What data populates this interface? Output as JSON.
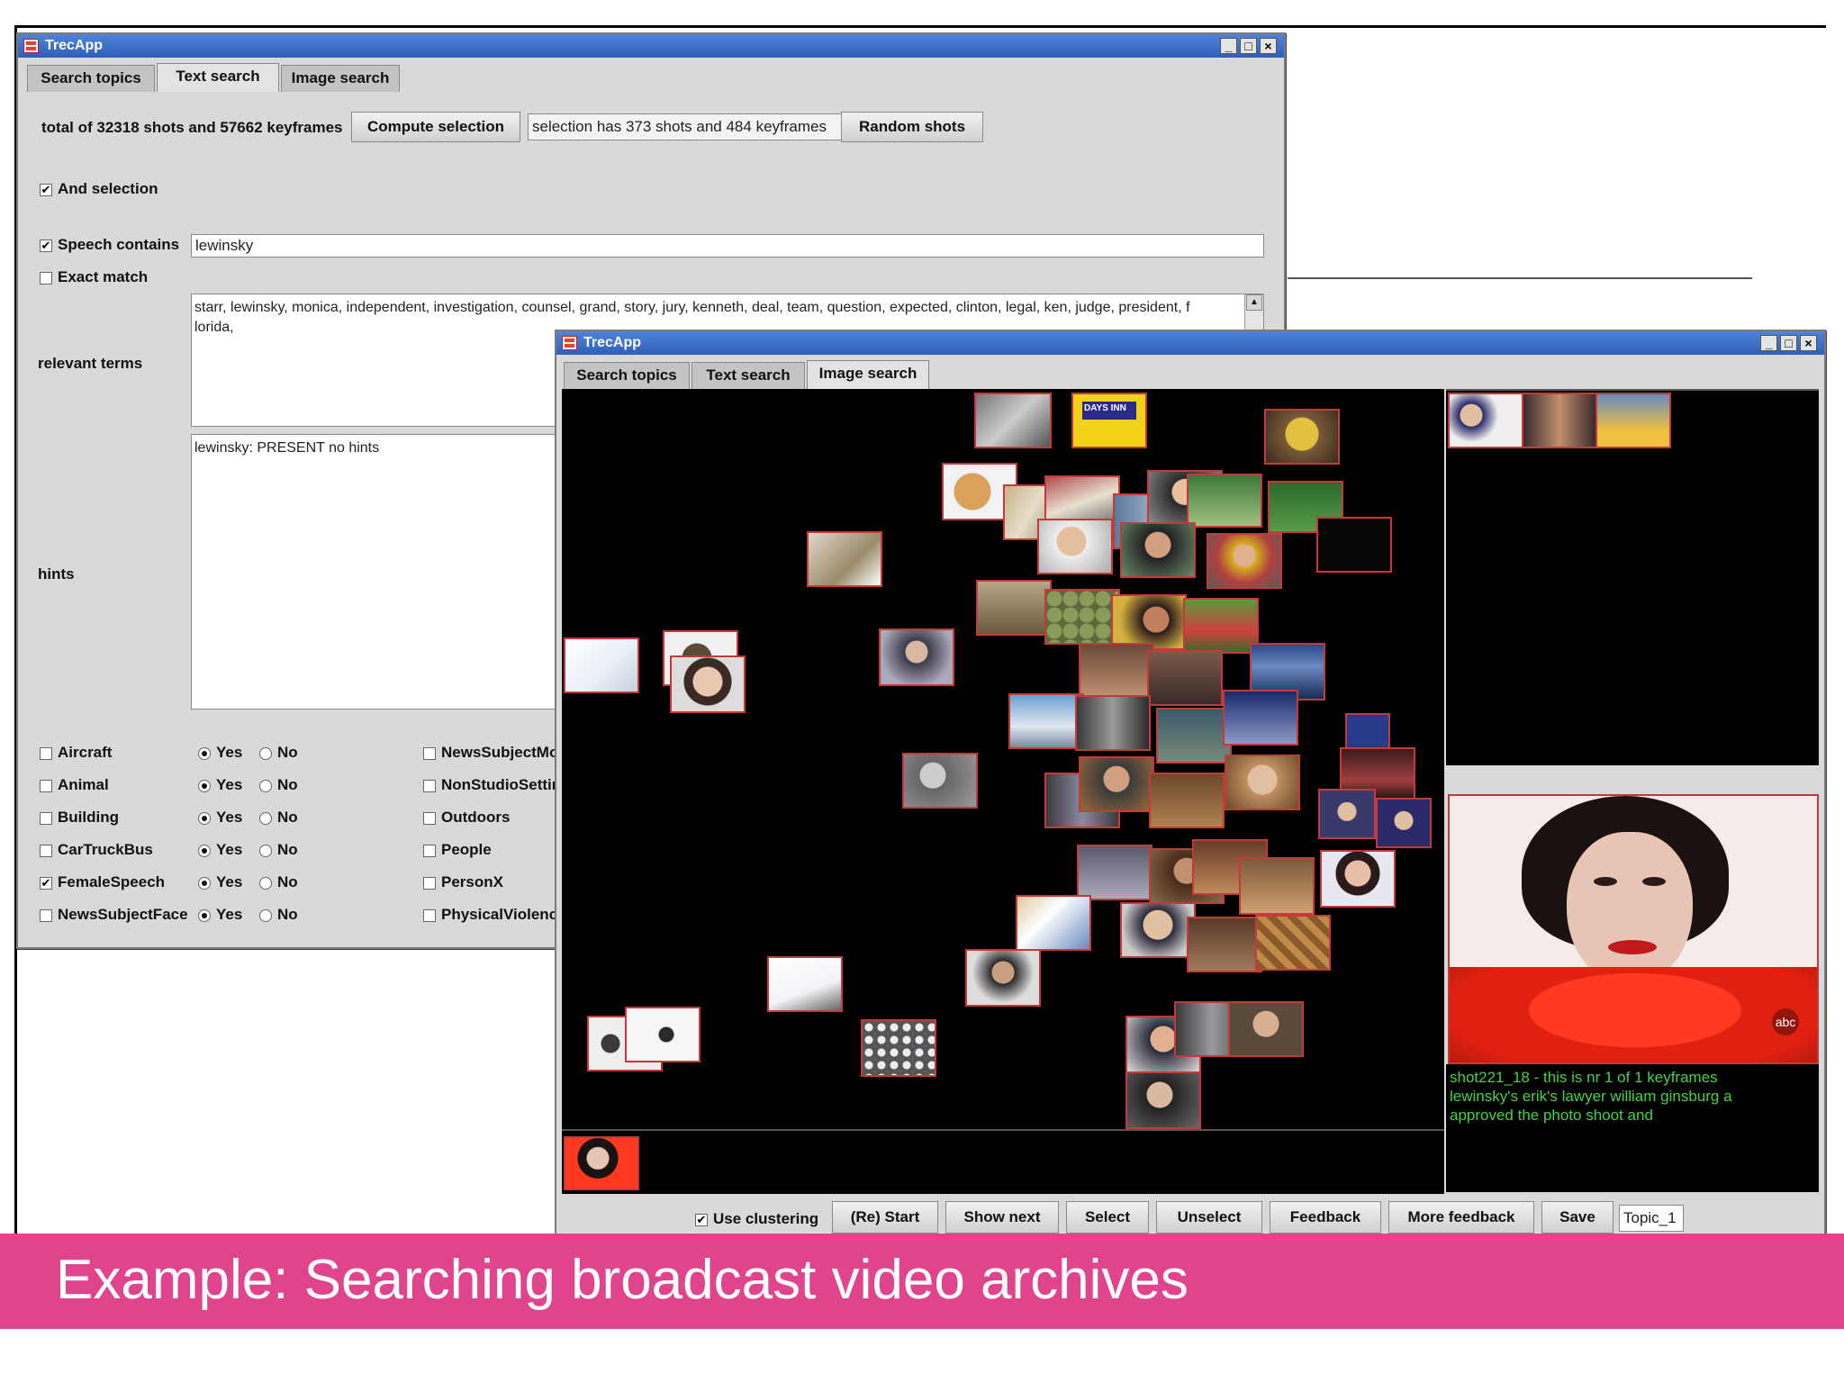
{
  "back_window": {
    "title": "TrecApp",
    "controls": [
      "_",
      "□",
      "×"
    ],
    "tabs": [
      {
        "label": "Search topics",
        "active": false
      },
      {
        "label": "Text search",
        "active": true
      },
      {
        "label": "Image search",
        "active": false
      }
    ],
    "totals_text": "total of 32318 shots and 57662 keyframes",
    "compute_selection_label": "Compute selection",
    "selection_status": "selection has 373 shots and 484 keyframes",
    "random_shots_label": "Random shots",
    "and_selection": {
      "label": "And selection",
      "checked": true
    },
    "speech_contains": {
      "label": "Speech contains",
      "checked": true,
      "value": "lewinsky"
    },
    "exact_match": {
      "label": "Exact match",
      "checked": false
    },
    "relevant_terms_label": "relevant terms",
    "relevant_terms_text": "starr, lewinsky, monica, independent, investigation, counsel, grand, story, jury, kenneth, deal, team, question, expected, clinton, legal, ken, judge, president, f\nlorida,",
    "hints_label": "hints",
    "hints_text": "lewinsky: PRESENT no hints",
    "features_left": [
      {
        "label": "Aircraft",
        "checked": false,
        "yes": "Yes",
        "no": "No",
        "value": "Yes"
      },
      {
        "label": "Animal",
        "checked": false,
        "yes": "Yes",
        "no": "No",
        "value": "Yes"
      },
      {
        "label": "Building",
        "checked": false,
        "yes": "Yes",
        "no": "No",
        "value": "Yes"
      },
      {
        "label": "CarTruckBus",
        "checked": false,
        "yes": "Yes",
        "no": "No",
        "value": "Yes"
      },
      {
        "label": "FemaleSpeech",
        "checked": true,
        "yes": "Yes",
        "no": "No",
        "value": "Yes"
      },
      {
        "label": "NewsSubjectFace",
        "checked": false,
        "yes": "Yes",
        "no": "No",
        "value": "Yes"
      }
    ],
    "features_right": [
      {
        "label": "NewsSubjectMo",
        "checked": false
      },
      {
        "label": "NonStudioSettin",
        "checked": false
      },
      {
        "label": "Outdoors",
        "checked": false
      },
      {
        "label": "People",
        "checked": false
      },
      {
        "label": "PersonX",
        "checked": false
      },
      {
        "label": "PhysicalViolenc",
        "checked": false
      }
    ]
  },
  "front_window": {
    "title": "TrecApp",
    "controls": [
      "_",
      "□",
      "×"
    ],
    "tabs": [
      {
        "label": "Search topics",
        "active": false
      },
      {
        "label": "Text search",
        "active": false
      },
      {
        "label": "Image search",
        "active": true
      }
    ],
    "logo_text": "DAYS INN",
    "preview_caption": "shot221_18 - this is nr 1 of 1 keyframes\nlewinsky's erik's lawyer william ginsburg a\n approved the photo shoot and",
    "preview_watermark": "abc",
    "toolbar": {
      "use_clustering": {
        "label": "Use clustering",
        "checked": true
      },
      "restart_label": "(Re) Start",
      "show_next_label": "Show next",
      "select_label": "Select",
      "unselect_label": "Unselect",
      "feedback_label": "Feedback",
      "more_feedback_label": "More feedback",
      "save_label": "Save",
      "topic_value": "Topic_1"
    },
    "colors": {
      "thumbnail_border": "#c23a3a",
      "caption_text": "#46d246",
      "canvas": "#000000"
    }
  },
  "banner": {
    "text": "Example: Searching broadcast video archives",
    "color": "#e0448d"
  }
}
